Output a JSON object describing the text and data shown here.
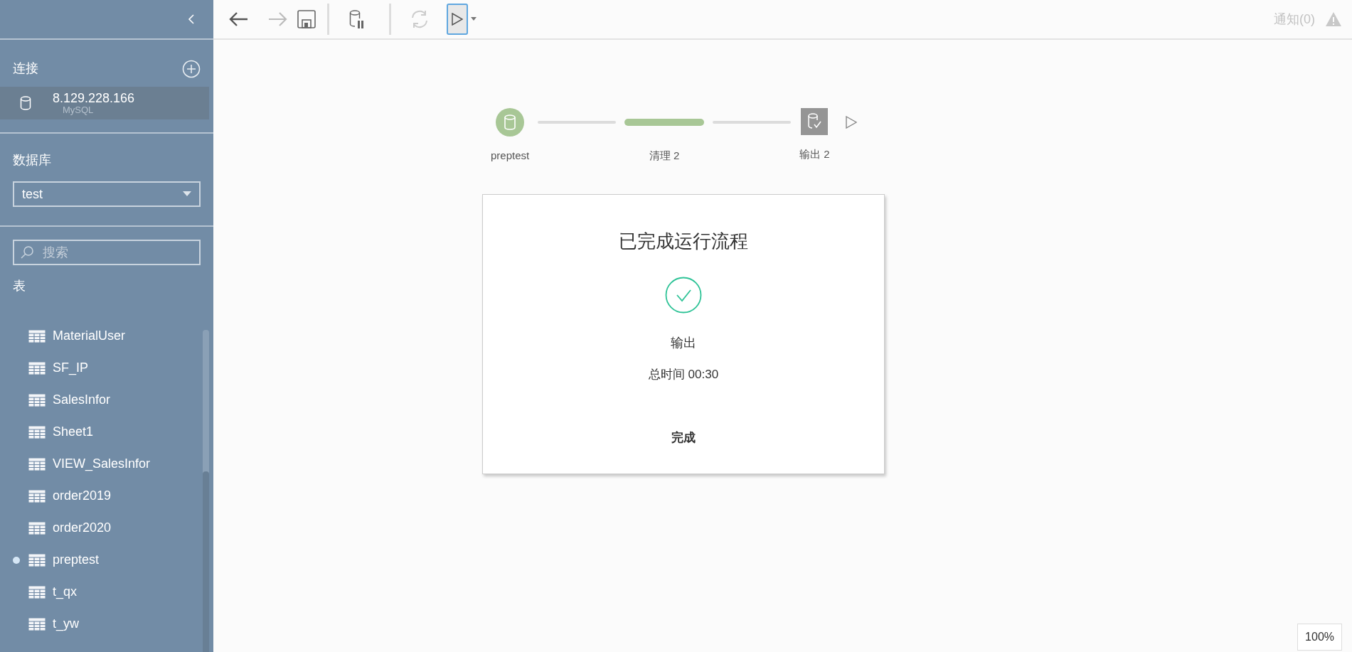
{
  "sidebar": {
    "connections_title": "连接",
    "connection": {
      "host": "8.129.228.166",
      "type": "MySQL",
      "selected": true
    },
    "database_title": "数据库",
    "database": "test",
    "search": {
      "placeholder": "搜索"
    },
    "tables_title": "表",
    "tables": [
      {
        "name": "MaterialUser",
        "in_use": false
      },
      {
        "name": "SF_IP",
        "in_use": false
      },
      {
        "name": "SalesInfor",
        "in_use": false
      },
      {
        "name": "Sheet1",
        "in_use": false
      },
      {
        "name": "VIEW_SalesInfor",
        "in_use": false
      },
      {
        "name": "order2019",
        "in_use": false
      },
      {
        "name": "order2020",
        "in_use": false
      },
      {
        "name": "preptest",
        "in_use": true
      },
      {
        "name": "t_qx",
        "in_use": false
      },
      {
        "name": "t_yw",
        "in_use": false
      }
    ]
  },
  "toolbar": {
    "notifications": "通知(0)",
    "run_selected": true
  },
  "flow": [
    {
      "kind": "input",
      "label": "preptest"
    },
    {
      "kind": "clean",
      "label": "清理 2"
    },
    {
      "kind": "output",
      "label": "输出 2"
    }
  ],
  "dialog": {
    "title": "已完成运行流程",
    "output_label": "输出",
    "total_time": "总时间 00:30",
    "done_button": "完成"
  },
  "zoom": "100%"
}
